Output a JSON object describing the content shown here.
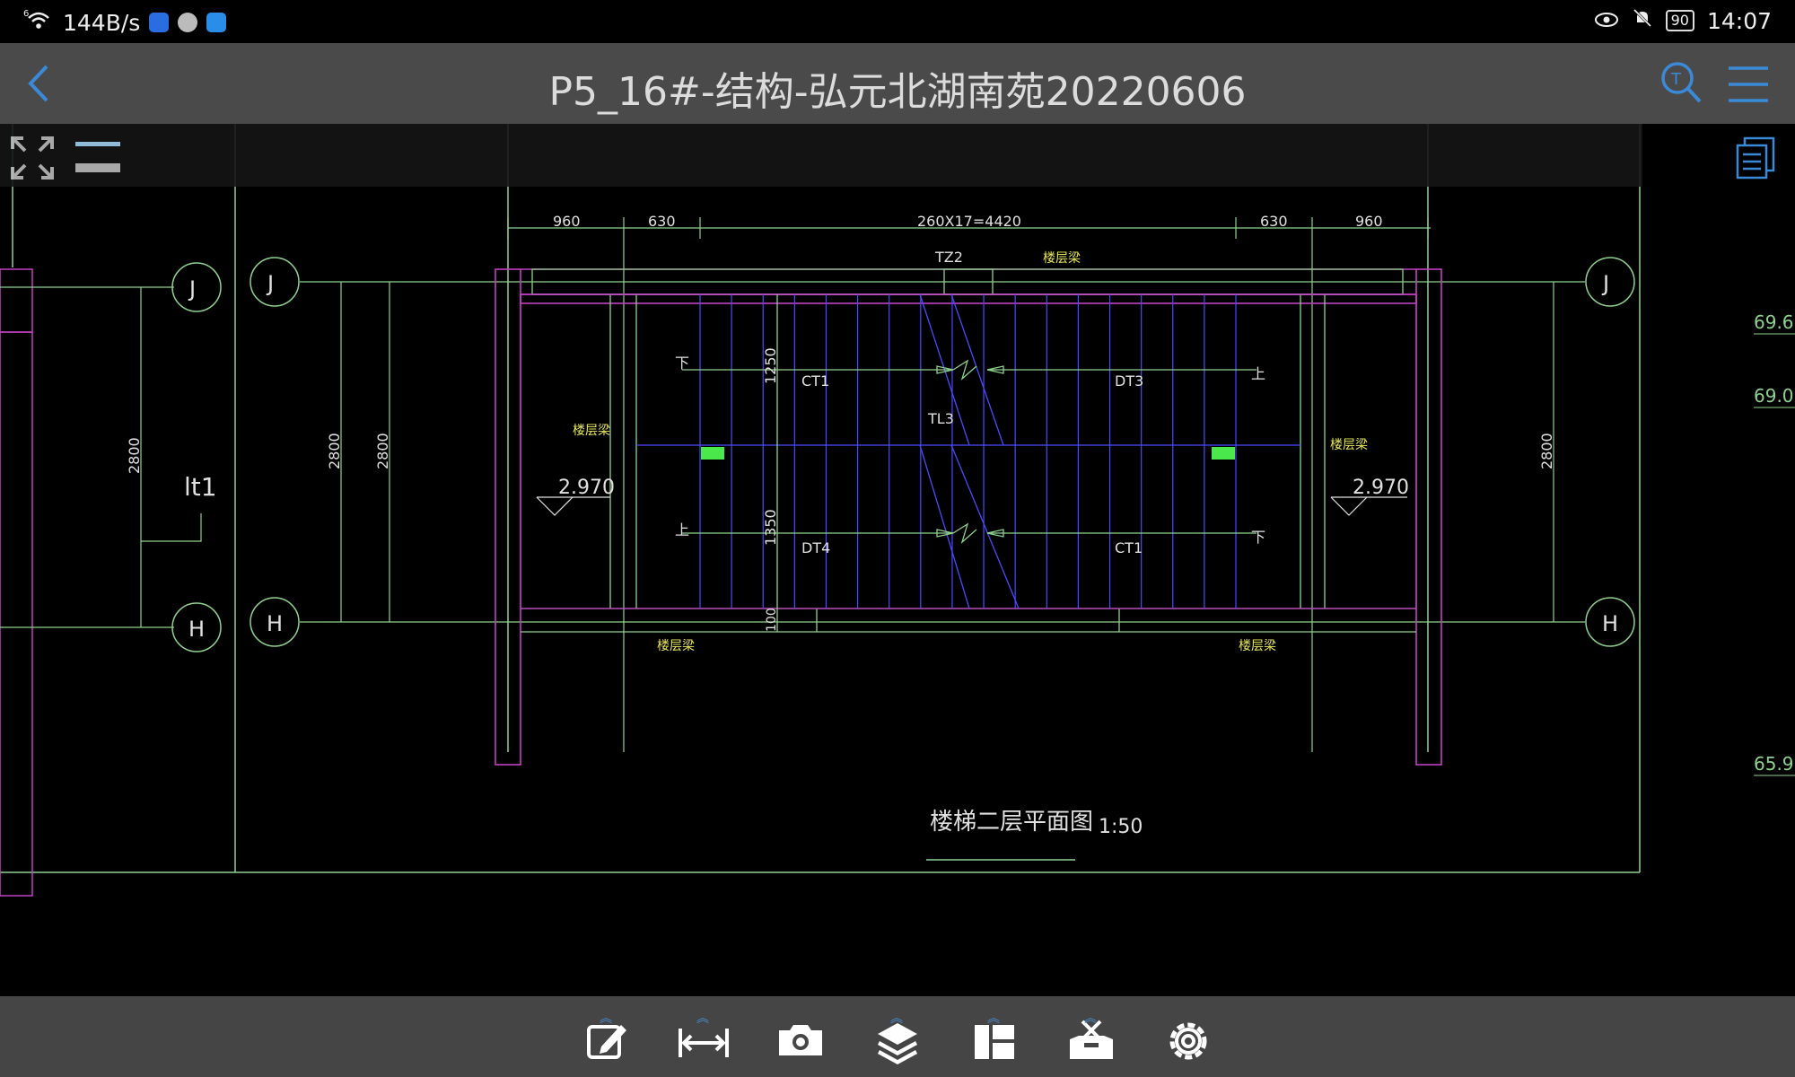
{
  "status_bar": {
    "signal": "6",
    "net_speed": "144B/s",
    "battery": "90",
    "time": "14:07"
  },
  "title_bar": {
    "title": "P5_16#-结构-弘元北湖南苑20220606"
  },
  "drawing": {
    "dims_top": [
      "960",
      "630",
      "260X17=4420",
      "630",
      "960"
    ],
    "axis_labels": [
      "J",
      "J",
      "J",
      "H",
      "H",
      "H"
    ],
    "dim_2800": "2800",
    "lt1": "lt1",
    "elev_left": "2.970",
    "elev_right": "2.970",
    "tz2": "TZ2",
    "beam_label": "楼层梁",
    "ct1": "CT1",
    "dt3": "DT3",
    "tl3": "TL3",
    "dt4": "DT4",
    "dim_1250": "1250",
    "dim_1350": "1350",
    "dim_100": "100",
    "down": "下",
    "up": "上",
    "caption_title": "楼梯二层平面图",
    "caption_scale": "1:50",
    "edge_values": [
      "69.6",
      "69.0",
      "65.9"
    ]
  },
  "colors": {
    "title_bar_bg": "#4a4a4a",
    "bottom_bar_bg": "#454545",
    "accent": "#3a8ad8",
    "cad_green": "#8fd18f",
    "cad_magenta": "#c040c0",
    "cad_blue": "#4a4aff",
    "cad_yellow": "#e8e85a"
  },
  "bottom_toolbar": {
    "items": [
      "edit-icon",
      "measure-icon",
      "camera-icon",
      "layers-icon",
      "layout-icon",
      "toolbox-icon",
      "settings-icon"
    ]
  }
}
